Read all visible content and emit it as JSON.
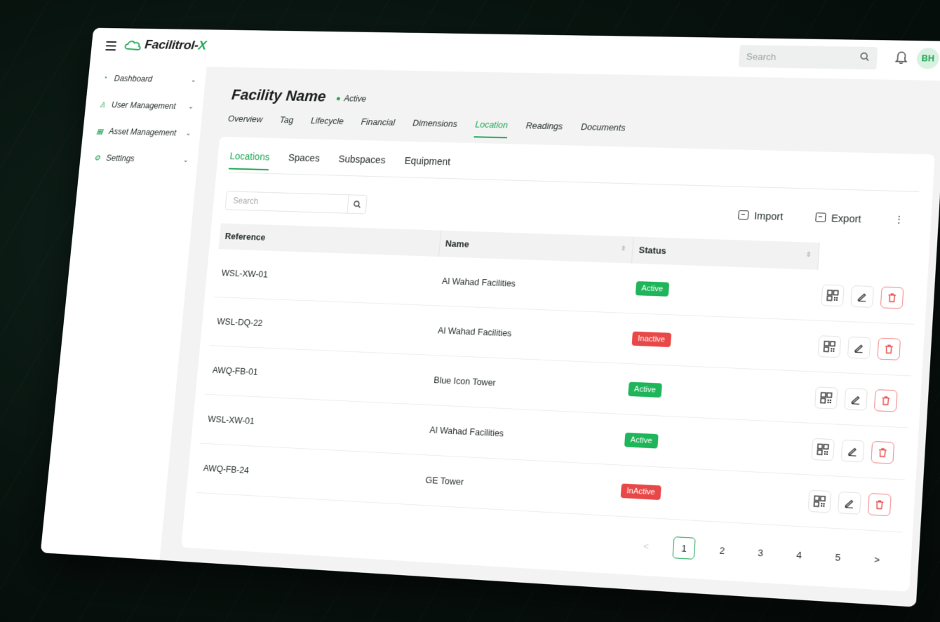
{
  "app": {
    "logo_text": "Facilitrol-",
    "logo_x": "X",
    "search_placeholder": "Search",
    "avatar_initials": "BH"
  },
  "sidebar": {
    "items": [
      {
        "label": "Dashboard",
        "icon": "dashboard-icon"
      },
      {
        "label": "User Management",
        "icon": "user-icon"
      },
      {
        "label": "Asset Management",
        "icon": "grid-icon"
      },
      {
        "label": "Settings",
        "icon": "gear-icon"
      }
    ]
  },
  "facility": {
    "title": "Facility Name",
    "status": "Active"
  },
  "tabs": [
    "Overview",
    "Tag",
    "Lifecycle",
    "Financial",
    "Dimensions",
    "Location",
    "Readings",
    "Documents"
  ],
  "active_tab": "Location",
  "subtabs": [
    "Locations",
    "Spaces",
    "Subspaces",
    "Equipment"
  ],
  "active_subtab": "Locations",
  "toolbar": {
    "search_placeholder": "Search",
    "import_label": "Import",
    "export_label": "Export"
  },
  "table": {
    "columns": [
      "Reference",
      "Name",
      "Status"
    ],
    "rows": [
      {
        "reference": "WSL-XW-01",
        "name": "Al Wahad Facilities",
        "status": "Active"
      },
      {
        "reference": "WSL-DQ-22",
        "name": "Al Wahad Facilities",
        "status": "Inactive"
      },
      {
        "reference": "AWQ-FB-01",
        "name": "Blue Icon Tower",
        "status": "Active"
      },
      {
        "reference": "WSL-XW-01",
        "name": "Al Wahad Facilities",
        "status": "Active"
      },
      {
        "reference": "AWQ-FB-24",
        "name": "GE Tower",
        "status": "InActive"
      }
    ]
  },
  "pagination": {
    "pages": [
      "1",
      "2",
      "3",
      "4",
      "5"
    ],
    "current": "1",
    "prev": "<",
    "next": ">"
  },
  "colors": {
    "accent": "#20a855",
    "active_badge": "#1fb55a",
    "inactive_badge": "#e84848"
  }
}
